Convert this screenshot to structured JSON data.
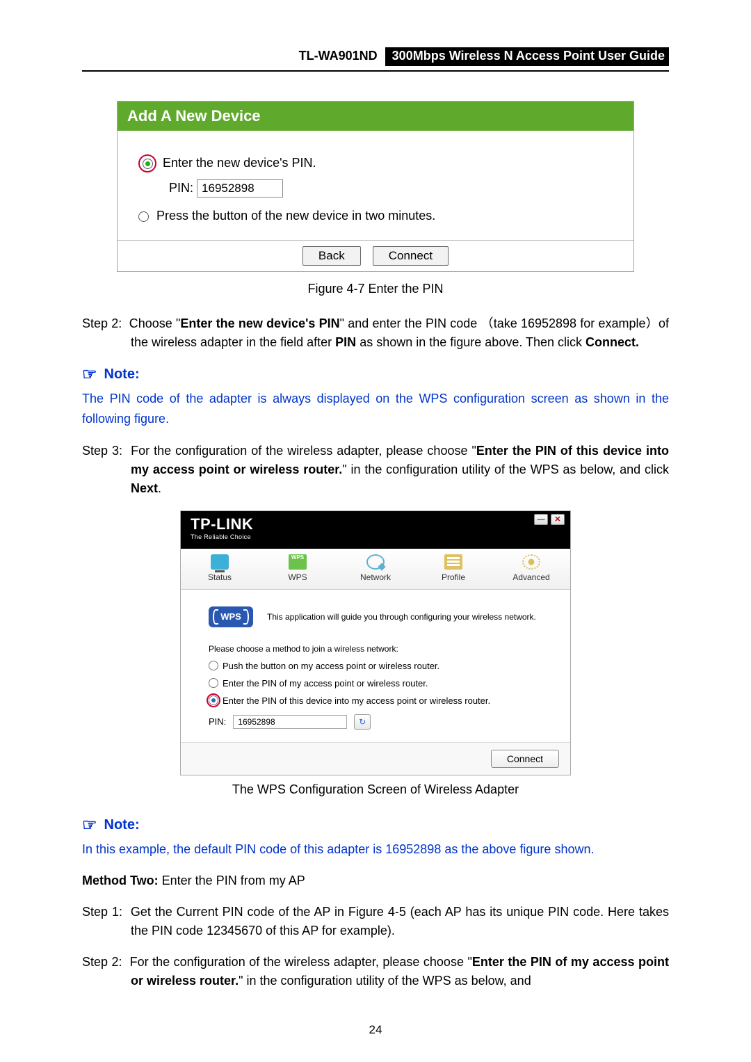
{
  "header": {
    "model": "TL-WA901ND",
    "title": "300Mbps Wireless N Access Point User Guide"
  },
  "figure1": {
    "panel_title": "Add A New Device",
    "opt1": "Enter the new device's PIN.",
    "pin_label": "PIN:",
    "pin_value": "16952898",
    "opt2": "Press the button of the new device in two minutes.",
    "btn_back": "Back",
    "btn_connect": "Connect",
    "caption": "Figure 4-7 Enter the PIN"
  },
  "step2": {
    "label": "Step 2:",
    "pre": "Choose \"",
    "bold1": "Enter the new device's PIN",
    "mid1": "\"  and  enter  the  PIN  code  （take  16952898  for example）of the wireless adapter in the field after ",
    "bold2": "PIN",
    "mid2": " as shown in the figure above. Then click ",
    "bold3": "Connect."
  },
  "note1": {
    "label": "Note:",
    "body": "The PIN code of the adapter is always displayed on the WPS configuration screen as shown in the following figure."
  },
  "step3": {
    "label": "Step 3:",
    "pre": "For  the  configuration  of  the  wireless  adapter,  please  choose  \"",
    "bold1": "Enter  the  PIN  of  this device into my access point or wireless router.",
    "mid1": "\" in the configuration utility of the WPS as below, and click ",
    "bold2": "Next"
  },
  "tplink": {
    "brand": "TP-LINK",
    "tagline": "The Reliable Choice",
    "tabs": [
      "Status",
      "WPS",
      "Network",
      "Profile",
      "Advanced"
    ],
    "guide": "This application will guide you through configuring your wireless network.",
    "choose": "Please choose a method to join a wireless network:",
    "opt1": "Push the button on my access point or wireless router.",
    "opt2": "Enter the PIN of my access point or wireless router.",
    "opt3": "Enter the PIN of this device into my access point or wireless router.",
    "pin_label": "PIN:",
    "pin_value": "16952898",
    "connect": "Connect"
  },
  "caption2": "The WPS Configuration Screen of Wireless Adapter",
  "note2": {
    "label": "Note:",
    "body": "In this example, the default PIN code of this adapter is 16952898 as the above figure shown."
  },
  "method2": {
    "label": "Method Two:",
    "rest": " Enter the PIN from my AP"
  },
  "m2_step1": {
    "label": "Step 1:",
    "body": "Get the Current PIN code of the AP in Figure 4-5 (each AP has its unique PIN code. Here takes the PIN code 12345670 of this AP for example)."
  },
  "m2_step2": {
    "label": "Step 2:",
    "pre": "For  the  configuration  of  the  wireless  adapter,  please  choose  \"",
    "bold1": "Enter  the  PIN  of  my access  point  or  wireless  router.",
    "post": "\"  in  the  configuration  utility  of  the  WPS  as  below,  and"
  },
  "page_number": "24"
}
